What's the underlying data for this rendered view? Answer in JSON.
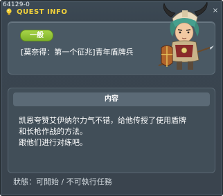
{
  "window": {
    "id_label": "64129-0",
    "title": "QUEST INFO",
    "close_glyph": "×"
  },
  "quest": {
    "category": "一般",
    "name": "[莫奈得：第一个征兆]青年盾牌兵"
  },
  "content": {
    "header": "内容",
    "lines": [
      "凯恩夸赞艾伊纳尔力气不错，给他传授了使用盾牌",
      "和长枪作战的方法。",
      "跟他们进行对练吧。"
    ]
  },
  "status": {
    "label": "狀態",
    "separator": "：",
    "value": "可開始 / 不可執行任務"
  },
  "icons": {
    "title_icon": "quest-bulb-icon",
    "npc": "npc-shield-soldier-portrait"
  },
  "colors": {
    "title": "#f3d23a",
    "badge": "#8fc235",
    "window_bg": "#3a444e"
  }
}
